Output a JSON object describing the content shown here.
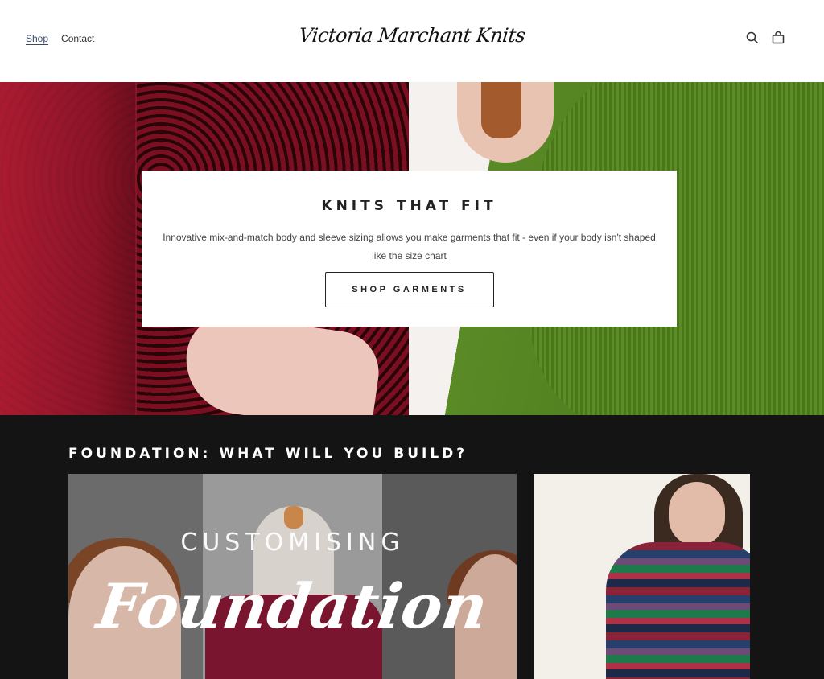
{
  "header": {
    "nav": [
      {
        "label": "Shop",
        "active": true
      },
      {
        "label": "Contact",
        "active": false
      }
    ],
    "logo": "Victoria Marchant Knits",
    "icons": [
      "search-icon",
      "bag-icon"
    ]
  },
  "hero": {
    "title": "KNITS THAT FIT",
    "text": "Innovative mix-and-match body and sleeve sizing allows you make garments that fit - even if your body isn't shaped like the size chart",
    "button": "SHOP GARMENTS"
  },
  "foundation": {
    "title": "FOUNDATION: WHAT WILL YOU BUILD?",
    "video_card": {
      "subtitle": "CUSTOMISING",
      "title": "Foundation"
    }
  },
  "colors": {
    "dark_section": "#141414",
    "hero_red": "#8c1428",
    "hero_green": "#5a8a26"
  }
}
